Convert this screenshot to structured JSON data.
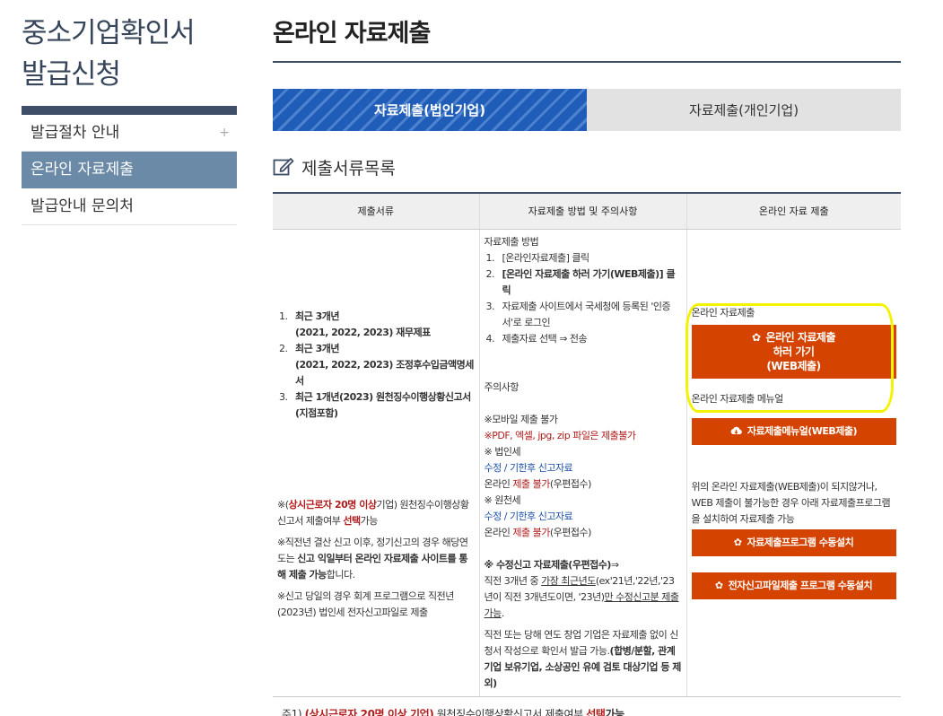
{
  "sidebar": {
    "title_line1": "중소기업확인서",
    "title_line2": "발급신청",
    "items": [
      {
        "label": "발급절차 안내",
        "plus": "+"
      },
      {
        "label": "온라인 자료제출"
      },
      {
        "label": "발급안내 문의처"
      }
    ]
  },
  "main": {
    "title": "온라인 자료제출",
    "tabs": [
      {
        "label": "자료제출(법인기업)"
      },
      {
        "label": "자료제출(개인기업)"
      }
    ],
    "section_title": "제출서류목록"
  },
  "table": {
    "headers": [
      "제출서류",
      "자료제출 방법 및 주의사항",
      "온라인 자료 제출"
    ],
    "col1": {
      "docs": [
        {
          "num": "1.",
          "line1": "최근 3개년",
          "line2": "(2021, 2022, 2023) 재무제표"
        },
        {
          "num": "2.",
          "line1": "최근 3개년",
          "line2": "(2021, 2022, 2023) 조정후수입금액명세서"
        },
        {
          "num": "3.",
          "line1": "최근 1개년(2023) 원천징수이행상황신고서",
          "line2": "(지점포함)"
        }
      ],
      "note1_a": "※(",
      "note1_red": "상시근로자 20명 이상",
      "note1_b": "기업) 원천징수이행상황신고서 제출여부 ",
      "note1_red2": "선택",
      "note1_c": "가능",
      "note2_a": "※직전년 결산 신고 이후, 정기신고의 경우 해당연도는 ",
      "note2_bold": "신고 익일부터 온라인 자료제출 사이트를 통해 제출 가능",
      "note2_c": "합니다.",
      "note3": "※신고 당일의 경우 회계 프로그램으로 직전년(2023년) 법인세 전자신고파일로 제출"
    },
    "col2": {
      "method_title": "자료제출 방법",
      "steps": [
        {
          "num": "1.",
          "text": "[온라인자료제출] 클릭"
        },
        {
          "num": "2.",
          "text": "[온라인 자료제출 하러 가기(WEB제출)] 클릭"
        },
        {
          "num": "3.",
          "text": "자료제출 사이트에서 국세청에 등록된 '인증서'로 로그인"
        },
        {
          "num": "4.",
          "text": "제출자료 선택 ⇒ 전송"
        }
      ],
      "caution_title": "주의사항",
      "mobile": "※모바일 제출 불가",
      "pdf": "※PDF, 엑셀, jpg, zip 파일은 제출불가",
      "corp_tax": "※ 법인세",
      "corp_late": "수정 / 기한후 신고자료",
      "corp_online_a": "온라인 ",
      "corp_online_red": "제출 불가",
      "corp_online_b": "(우편접수)",
      "withholding": "※ 원천세",
      "with_late": "수정 / 기한후 신고자료",
      "with_online_a": "온라인 ",
      "with_online_red": "제출 불가",
      "with_online_b": "(우편접수)",
      "amend_title": "※ 수정신고 자료제출(우편접수)",
      "amend_arrow": "⇒",
      "amend_a": "직전 3개년 중 ",
      "amend_u1": "가장 최근년도",
      "amend_b": "(ex'21년,'22년,'23년이 직전 3개년도이면, '23년)",
      "amend_u2": "만 수정신고분 제출가능",
      "amend_c": ".",
      "startup_a": "직전 또는 당해 연도 창업 기업은 자료제출 없이 신청서 작성으로 확인서 발급 가능.",
      "startup_bold": "(합병/분할, 관계기업 보유기업, 소상공인 유예 검토 대상기업 등 제외)"
    },
    "col3": {
      "online_label": "온라인 자료제출",
      "web_btn_line1": "온라인 자료제출",
      "web_btn_line2": "하러 가기",
      "web_btn_line3": "(WEB제출)",
      "manual_label": "온라인 자료제출 메뉴얼",
      "manual_btn": "자료제출메뉴얼(WEB제출)",
      "install_text": "위의 온라인 자료제출(WEB제출)이 되지않거나, WEB 제출이 불가능한 경우 아래 자료제출프로그램을 설치하여 자료제출 가능",
      "install_btn": "자료제출프로그램 수동설치",
      "efile_btn": "전자신고파일제출 프로그램 수동설치"
    }
  },
  "footnote": {
    "a": "주1) ",
    "red": "(상시근로자 20명 이상 기업)",
    "b": " 원천징수이행상황신고서 제출여부 ",
    "red2": "선택",
    "c": "가능"
  },
  "colors": {
    "accent": "#1f5db8",
    "button": "#d44400",
    "highlight": "#f5f200",
    "sidebar_active": "#6b8aa8"
  },
  "icons": [
    "edit-icon",
    "gear-icon",
    "cloud-download-icon"
  ]
}
